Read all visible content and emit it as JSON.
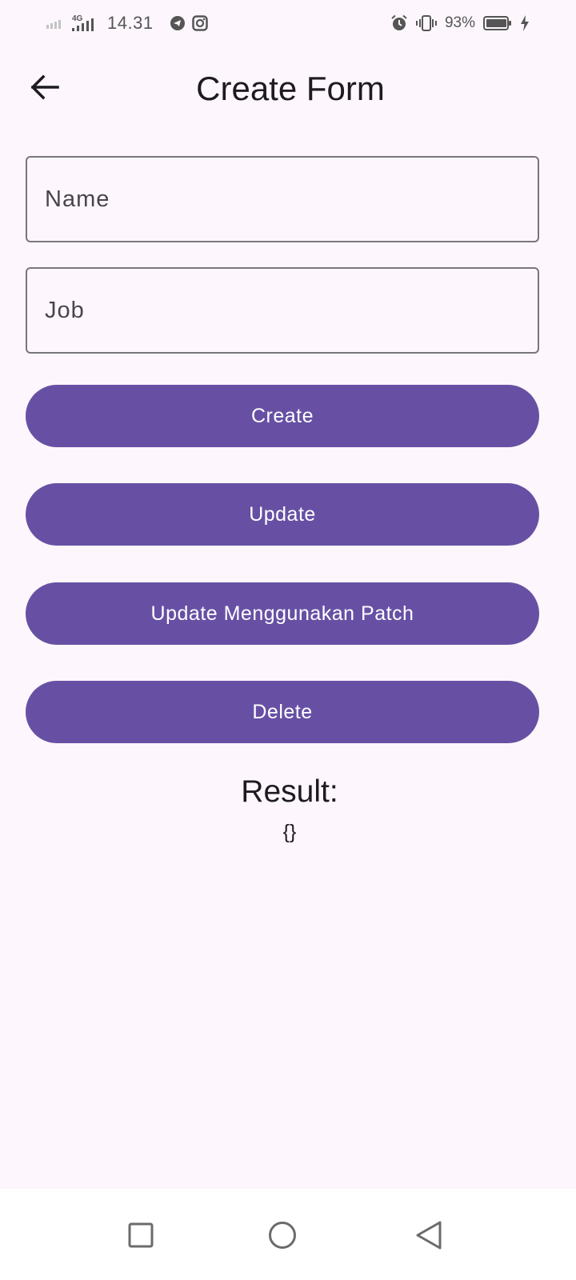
{
  "status_bar": {
    "network_label": "4G",
    "time": "14.31",
    "battery_percent": "93%",
    "icons": [
      "signal-weak-icon",
      "signal-4g-icon",
      "telegram-icon",
      "instagram-icon",
      "alarm-icon",
      "vibrate-icon",
      "battery-icon",
      "charging-icon"
    ]
  },
  "app_bar": {
    "title": "Create Form",
    "back_icon": "arrow-left-icon"
  },
  "form": {
    "name_placeholder": "Name",
    "name_value": "",
    "job_placeholder": "Job",
    "job_value": ""
  },
  "buttons": {
    "create": "Create",
    "update": "Update",
    "patch": "Update Menggunakan Patch",
    "delete": "Delete"
  },
  "result": {
    "label": "Result:",
    "value": "{}"
  },
  "nav_bar": {
    "icons": [
      "recents-square-icon",
      "home-circle-icon",
      "back-triangle-icon"
    ]
  },
  "colors": {
    "background": "#FDF7FD",
    "primary": "#6750A4",
    "on_primary": "#FFFFFF",
    "outline": "#79747E",
    "text": "#1D1B20"
  }
}
